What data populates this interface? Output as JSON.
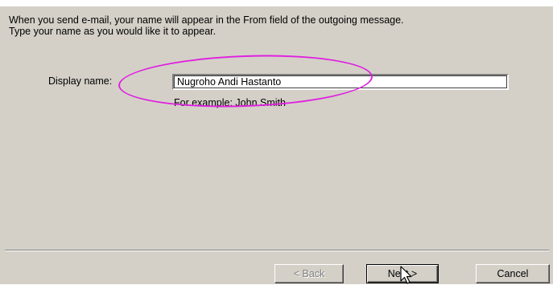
{
  "wizard": {
    "intro_text": "When you send e-mail, your name will appear in the From field of the outgoing message.\nType your name as you would like it to appear.",
    "display_name_label": "Display name:",
    "display_name_value": "Nugroho Andi Hastanto",
    "example_text": "For example: John Smith"
  },
  "buttons": {
    "back_label": "< Back",
    "next_label": "Next >",
    "cancel_label": "Cancel"
  },
  "annotation": {
    "highlight_color": "#e020e0"
  },
  "icons": {
    "cursor": "mouse-pointer-icon"
  }
}
